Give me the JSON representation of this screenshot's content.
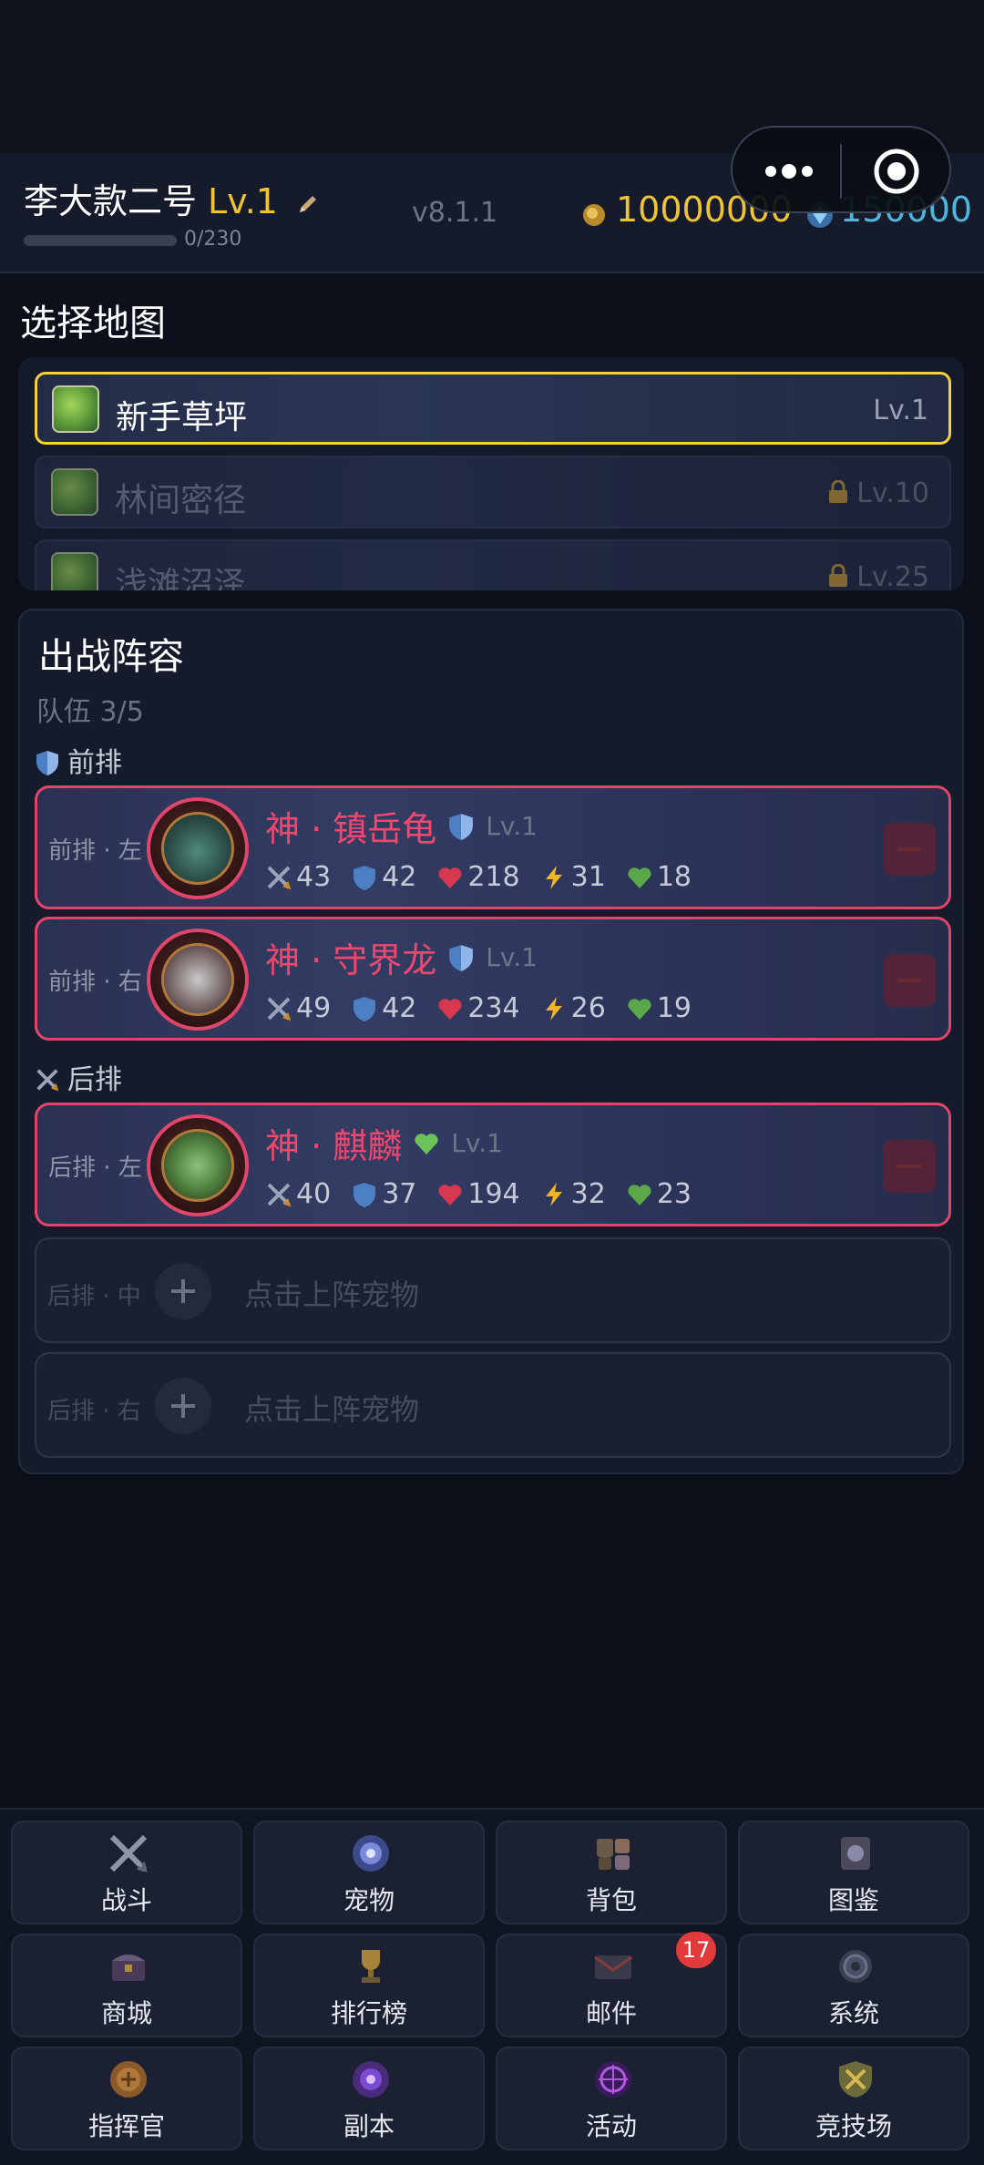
{
  "header": {
    "player_name": "李大款二号",
    "player_level": "Lv.1",
    "exp_text": "0/230",
    "version": "v8.1.1",
    "gold": "10000000",
    "gems": "150000"
  },
  "map_section": {
    "title": "选择地图",
    "maps": [
      {
        "name": "新手草坪",
        "level": "Lv.1",
        "selected": true,
        "locked": false
      },
      {
        "name": "林间密径",
        "level": "Lv.10",
        "selected": false,
        "locked": true
      },
      {
        "name": "浅滩沼泽",
        "level": "Lv.25",
        "selected": false,
        "locked": true
      }
    ]
  },
  "team_section": {
    "title": "出战阵容",
    "team_count": "队伍 3/5",
    "front_row_label": "前排",
    "back_row_label": "后排",
    "pets": [
      {
        "slot": "前排 · 左",
        "name": "神 · 镇岳龟",
        "level": "Lv.1",
        "role_icon": "shield-icon",
        "atk": "43",
        "def": "42",
        "hp": "218",
        "spd": "31",
        "heal": "18"
      },
      {
        "slot": "前排 · 右",
        "name": "神 · 守界龙",
        "level": "Lv.1",
        "role_icon": "shield-icon",
        "atk": "49",
        "def": "42",
        "hp": "234",
        "spd": "26",
        "heal": "19"
      },
      {
        "slot": "后排 · 左",
        "name": "神 · 麒麟",
        "level": "Lv.1",
        "role_icon": "heart-icon",
        "atk": "40",
        "def": "37",
        "hp": "194",
        "spd": "32",
        "heal": "23"
      }
    ],
    "empty_slots": [
      {
        "slot": "后排 · 中",
        "text": "点击上阵宠物"
      },
      {
        "slot": "后排 · 右",
        "text": "点击上阵宠物"
      }
    ]
  },
  "bottom_nav": {
    "items": [
      {
        "label": "战斗",
        "icon": "crossed-swords-icon"
      },
      {
        "label": "宠物",
        "icon": "pet-orb-icon"
      },
      {
        "label": "背包",
        "icon": "backpack-icon"
      },
      {
        "label": "图鉴",
        "icon": "codex-book-icon"
      },
      {
        "label": "商城",
        "icon": "shop-chest-icon"
      },
      {
        "label": "排行榜",
        "icon": "trophy-icon"
      },
      {
        "label": "邮件",
        "icon": "mail-icon",
        "badge": "17"
      },
      {
        "label": "系统",
        "icon": "gear-icon"
      },
      {
        "label": "指挥官",
        "icon": "commander-scroll-icon"
      },
      {
        "label": "副本",
        "icon": "portal-icon"
      },
      {
        "label": "活动",
        "icon": "event-sigil-icon"
      },
      {
        "label": "竞技场",
        "icon": "arena-shield-icon"
      }
    ]
  },
  "colors": {
    "accent_gold": "#f1c232",
    "accent_gem": "#4fb6e0",
    "pet_border": "#e0456a",
    "selected_map_border": "#f5d23a"
  }
}
